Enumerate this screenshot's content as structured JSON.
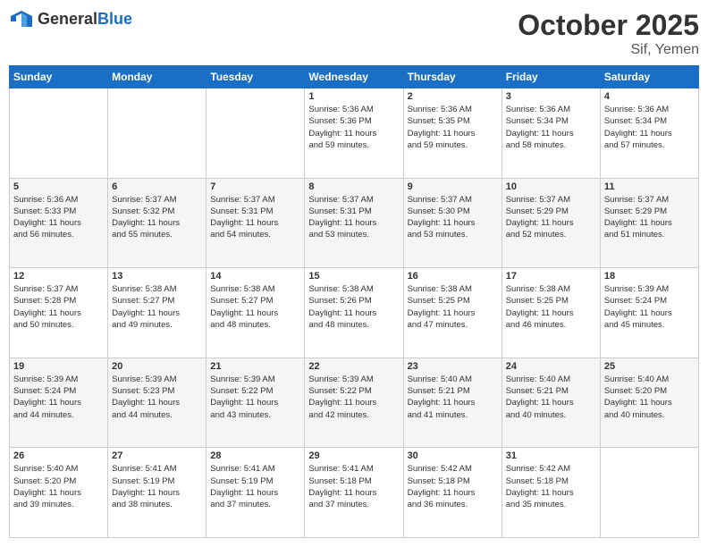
{
  "header": {
    "logo_general": "General",
    "logo_blue": "Blue",
    "month": "October 2025",
    "location": "Sif, Yemen"
  },
  "weekdays": [
    "Sunday",
    "Monday",
    "Tuesday",
    "Wednesday",
    "Thursday",
    "Friday",
    "Saturday"
  ],
  "weeks": [
    [
      {
        "day": "",
        "info": ""
      },
      {
        "day": "",
        "info": ""
      },
      {
        "day": "",
        "info": ""
      },
      {
        "day": "1",
        "info": "Sunrise: 5:36 AM\nSunset: 5:36 PM\nDaylight: 11 hours\nand 59 minutes."
      },
      {
        "day": "2",
        "info": "Sunrise: 5:36 AM\nSunset: 5:35 PM\nDaylight: 11 hours\nand 59 minutes."
      },
      {
        "day": "3",
        "info": "Sunrise: 5:36 AM\nSunset: 5:34 PM\nDaylight: 11 hours\nand 58 minutes."
      },
      {
        "day": "4",
        "info": "Sunrise: 5:36 AM\nSunset: 5:34 PM\nDaylight: 11 hours\nand 57 minutes."
      }
    ],
    [
      {
        "day": "5",
        "info": "Sunrise: 5:36 AM\nSunset: 5:33 PM\nDaylight: 11 hours\nand 56 minutes."
      },
      {
        "day": "6",
        "info": "Sunrise: 5:37 AM\nSunset: 5:32 PM\nDaylight: 11 hours\nand 55 minutes."
      },
      {
        "day": "7",
        "info": "Sunrise: 5:37 AM\nSunset: 5:31 PM\nDaylight: 11 hours\nand 54 minutes."
      },
      {
        "day": "8",
        "info": "Sunrise: 5:37 AM\nSunset: 5:31 PM\nDaylight: 11 hours\nand 53 minutes."
      },
      {
        "day": "9",
        "info": "Sunrise: 5:37 AM\nSunset: 5:30 PM\nDaylight: 11 hours\nand 53 minutes."
      },
      {
        "day": "10",
        "info": "Sunrise: 5:37 AM\nSunset: 5:29 PM\nDaylight: 11 hours\nand 52 minutes."
      },
      {
        "day": "11",
        "info": "Sunrise: 5:37 AM\nSunset: 5:29 PM\nDaylight: 11 hours\nand 51 minutes."
      }
    ],
    [
      {
        "day": "12",
        "info": "Sunrise: 5:37 AM\nSunset: 5:28 PM\nDaylight: 11 hours\nand 50 minutes."
      },
      {
        "day": "13",
        "info": "Sunrise: 5:38 AM\nSunset: 5:27 PM\nDaylight: 11 hours\nand 49 minutes."
      },
      {
        "day": "14",
        "info": "Sunrise: 5:38 AM\nSunset: 5:27 PM\nDaylight: 11 hours\nand 48 minutes."
      },
      {
        "day": "15",
        "info": "Sunrise: 5:38 AM\nSunset: 5:26 PM\nDaylight: 11 hours\nand 48 minutes."
      },
      {
        "day": "16",
        "info": "Sunrise: 5:38 AM\nSunset: 5:25 PM\nDaylight: 11 hours\nand 47 minutes."
      },
      {
        "day": "17",
        "info": "Sunrise: 5:38 AM\nSunset: 5:25 PM\nDaylight: 11 hours\nand 46 minutes."
      },
      {
        "day": "18",
        "info": "Sunrise: 5:39 AM\nSunset: 5:24 PM\nDaylight: 11 hours\nand 45 minutes."
      }
    ],
    [
      {
        "day": "19",
        "info": "Sunrise: 5:39 AM\nSunset: 5:24 PM\nDaylight: 11 hours\nand 44 minutes."
      },
      {
        "day": "20",
        "info": "Sunrise: 5:39 AM\nSunset: 5:23 PM\nDaylight: 11 hours\nand 44 minutes."
      },
      {
        "day": "21",
        "info": "Sunrise: 5:39 AM\nSunset: 5:22 PM\nDaylight: 11 hours\nand 43 minutes."
      },
      {
        "day": "22",
        "info": "Sunrise: 5:39 AM\nSunset: 5:22 PM\nDaylight: 11 hours\nand 42 minutes."
      },
      {
        "day": "23",
        "info": "Sunrise: 5:40 AM\nSunset: 5:21 PM\nDaylight: 11 hours\nand 41 minutes."
      },
      {
        "day": "24",
        "info": "Sunrise: 5:40 AM\nSunset: 5:21 PM\nDaylight: 11 hours\nand 40 minutes."
      },
      {
        "day": "25",
        "info": "Sunrise: 5:40 AM\nSunset: 5:20 PM\nDaylight: 11 hours\nand 40 minutes."
      }
    ],
    [
      {
        "day": "26",
        "info": "Sunrise: 5:40 AM\nSunset: 5:20 PM\nDaylight: 11 hours\nand 39 minutes."
      },
      {
        "day": "27",
        "info": "Sunrise: 5:41 AM\nSunset: 5:19 PM\nDaylight: 11 hours\nand 38 minutes."
      },
      {
        "day": "28",
        "info": "Sunrise: 5:41 AM\nSunset: 5:19 PM\nDaylight: 11 hours\nand 37 minutes."
      },
      {
        "day": "29",
        "info": "Sunrise: 5:41 AM\nSunset: 5:18 PM\nDaylight: 11 hours\nand 37 minutes."
      },
      {
        "day": "30",
        "info": "Sunrise: 5:42 AM\nSunset: 5:18 PM\nDaylight: 11 hours\nand 36 minutes."
      },
      {
        "day": "31",
        "info": "Sunrise: 5:42 AM\nSunset: 5:18 PM\nDaylight: 11 hours\nand 35 minutes."
      },
      {
        "day": "",
        "info": ""
      }
    ]
  ]
}
